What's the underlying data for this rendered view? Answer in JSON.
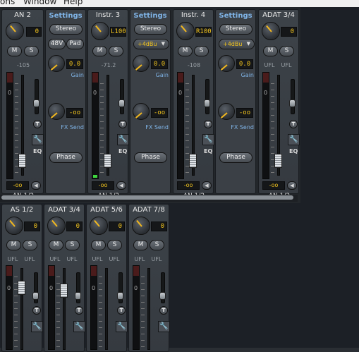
{
  "menu": {
    "items": [
      "ons",
      "Window",
      "Help"
    ]
  },
  "upper_strips": [
    {
      "title": "AN 2",
      "gain_value": "0",
      "peak": "-105",
      "level": "-oo",
      "routing": "AN 1/2",
      "has_green": false
    },
    {
      "title": "Instr. 3",
      "gain_value": "L100",
      "peak": "-71.2",
      "level": "-oo",
      "routing": "AN 1/2",
      "has_green": true
    },
    {
      "title": "Instr. 4",
      "gain_value": "R100",
      "peak": "-108",
      "level": "-oo",
      "routing": "AN 1/2",
      "has_green": false
    },
    {
      "title": "ADAT 3/4",
      "gain_value": "0",
      "peak_left": "UFL",
      "peak_right": "UFL",
      "level": "-oo",
      "routing": "AN 1/2",
      "has_green": false
    }
  ],
  "settings_panels": [
    {
      "title": "Settings",
      "stereo": "Stereo",
      "btn_a": "48V",
      "btn_b": "Pad",
      "gain_value": "0.0",
      "gain_label": "Gain",
      "fx_value": "-oo",
      "fx_label": "FX Send",
      "phase": "Phase"
    },
    {
      "title": "Settings",
      "stereo": "Stereo",
      "dropdown": "+4dBu",
      "gain_value": "0.0",
      "gain_label": "Gain",
      "fx_value": "-oo",
      "fx_label": "FX Send",
      "phase": "Phase"
    },
    {
      "title": "Settings",
      "stereo": "Stereo",
      "dropdown": "+4dBu",
      "gain_value": "0.0",
      "gain_label": "Gain",
      "fx_value": "-oo",
      "fx_label": "FX Send",
      "phase": "Phase"
    }
  ],
  "lower_strips": [
    {
      "title": "AS 1/2",
      "gain_value": "0",
      "peak_left": "UFL",
      "peak_right": "UFL"
    },
    {
      "title": "ADAT 3/4",
      "gain_value": "0",
      "peak_left": "UFL",
      "peak_right": "UFL"
    },
    {
      "title": "ADAT 5/6",
      "gain_value": "0",
      "peak_left": "UFL",
      "peak_right": "UFL"
    },
    {
      "title": "ADAT 7/8",
      "gain_value": "0",
      "peak_left": "UFL",
      "peak_right": "UFL"
    }
  ],
  "labels": {
    "mute": "M",
    "solo": "S",
    "zero": "0",
    "trim": "T",
    "eq": "EQ",
    "wrench": "🔧",
    "arrow": "◀"
  }
}
